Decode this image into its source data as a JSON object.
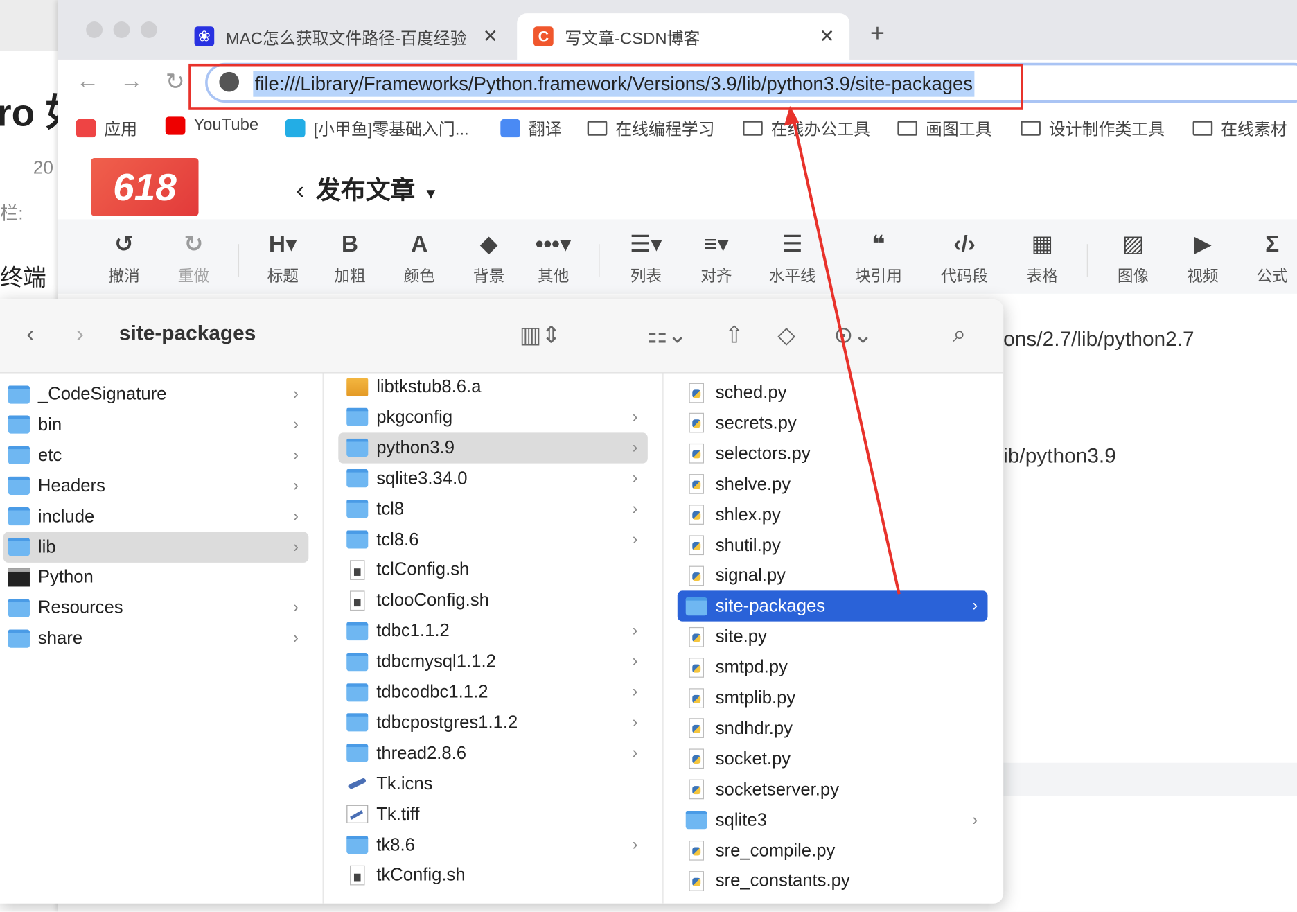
{
  "background_window": {
    "texts": [
      "ro 如",
      "20",
      "栏:",
      "终端"
    ]
  },
  "browser": {
    "tabs": [
      {
        "title": "MAC怎么获取文件路径-百度经验",
        "favicon": "baidu-paw-icon",
        "active": false
      },
      {
        "title": "写文章-CSDN博客",
        "favicon": "csdn-c-icon",
        "active": true
      }
    ],
    "new_tab": "+",
    "close": "✕",
    "url": "file:///Library/Frameworks/Python.framework/Versions/3.9/lib/python3.9/site-packages",
    "bookmarks": [
      {
        "label": "应用",
        "icon": "apps-grid-icon"
      },
      {
        "label": "YouTube",
        "icon": "youtube-icon"
      },
      {
        "label": "[小甲鱼]零基础入门...",
        "icon": "bilibili-icon"
      },
      {
        "label": "翻译",
        "icon": "google-translate-icon"
      },
      {
        "label": "在线编程学习",
        "icon": "folder-icon"
      },
      {
        "label": "在线办公工具",
        "icon": "folder-icon"
      },
      {
        "label": "画图工具",
        "icon": "folder-icon"
      },
      {
        "label": "设计制作类工具",
        "icon": "folder-icon"
      },
      {
        "label": "在线素材",
        "icon": "folder-icon"
      }
    ],
    "colors": {
      "annotation_red": "#e8322b",
      "selection": "#b7d4fb",
      "finder_selection": "#2a62d8"
    }
  },
  "csdn": {
    "logo": "618",
    "title": "发布文章",
    "tools": [
      {
        "glyph": "↺",
        "label": "撤消"
      },
      {
        "glyph": "↻",
        "label": "重做"
      },
      {
        "glyph": "H▾",
        "label": "标题"
      },
      {
        "glyph": "B",
        "label": "加粗"
      },
      {
        "glyph": "A",
        "label": "颜色"
      },
      {
        "glyph": "◆",
        "label": "背景"
      },
      {
        "glyph": "•••▾",
        "label": "其他"
      },
      {
        "glyph": "☰▾",
        "label": "列表"
      },
      {
        "glyph": "≡▾",
        "label": "对齐"
      },
      {
        "glyph": "☰",
        "label": "水平线"
      },
      {
        "glyph": "❝",
        "label": "块引用"
      },
      {
        "glyph": "‹/›",
        "label": "代码段"
      },
      {
        "glyph": "▦",
        "label": "表格"
      },
      {
        "glyph": "▨",
        "label": "图像"
      },
      {
        "glyph": "▶",
        "label": "视频"
      },
      {
        "glyph": "Σ",
        "label": "公式"
      }
    ],
    "page_text": [
      "ons/2.7/lib/python2.7",
      "ib/python3.9"
    ]
  },
  "finder": {
    "title": "site-packages",
    "columns": [
      [
        {
          "name": "_CodeSignature",
          "icon": "folder",
          "chevron": true
        },
        {
          "name": "bin",
          "icon": "folder",
          "chevron": true
        },
        {
          "name": "etc",
          "icon": "folder",
          "chevron": true
        },
        {
          "name": "Headers",
          "icon": "folder",
          "chevron": true
        },
        {
          "name": "include",
          "icon": "folder",
          "chevron": true
        },
        {
          "name": "lib",
          "icon": "folder",
          "chevron": true,
          "state": "selected"
        },
        {
          "name": "Python",
          "icon": "exec",
          "chevron": false
        },
        {
          "name": "Resources",
          "icon": "folder",
          "chevron": true
        },
        {
          "name": "share",
          "icon": "folder",
          "chevron": true
        }
      ],
      [
        {
          "name": "libtkstub8.6.a",
          "icon": "ar",
          "chevron": false
        },
        {
          "name": "pkgconfig",
          "icon": "folder",
          "chevron": true
        },
        {
          "name": "python3.9",
          "icon": "folder",
          "chevron": true,
          "state": "selected"
        },
        {
          "name": "sqlite3.34.0",
          "icon": "folder",
          "chevron": true
        },
        {
          "name": "tcl8",
          "icon": "folder",
          "chevron": true
        },
        {
          "name": "tcl8.6",
          "icon": "folder",
          "chevron": true
        },
        {
          "name": "tclConfig.sh",
          "icon": "sh",
          "chevron": false
        },
        {
          "name": "tclooConfig.sh",
          "icon": "sh",
          "chevron": false
        },
        {
          "name": "tdbc1.1.2",
          "icon": "folder",
          "chevron": true
        },
        {
          "name": "tdbcmysql1.1.2",
          "icon": "folder",
          "chevron": true
        },
        {
          "name": "tdbcodbc1.1.2",
          "icon": "folder",
          "chevron": true
        },
        {
          "name": "tdbcpostgres1.1.2",
          "icon": "folder",
          "chevron": true
        },
        {
          "name": "thread2.8.6",
          "icon": "folder",
          "chevron": true
        },
        {
          "name": "Tk.icns",
          "icon": "icns",
          "chevron": false
        },
        {
          "name": "Tk.tiff",
          "icon": "tiff",
          "chevron": false
        },
        {
          "name": "tk8.6",
          "icon": "folder",
          "chevron": true
        },
        {
          "name": "tkConfig.sh",
          "icon": "sh",
          "chevron": false
        }
      ],
      [
        {
          "name": "sched.py",
          "icon": "py",
          "chevron": false
        },
        {
          "name": "secrets.py",
          "icon": "py",
          "chevron": false
        },
        {
          "name": "selectors.py",
          "icon": "py",
          "chevron": false
        },
        {
          "name": "shelve.py",
          "icon": "py",
          "chevron": false
        },
        {
          "name": "shlex.py",
          "icon": "py",
          "chevron": false
        },
        {
          "name": "shutil.py",
          "icon": "py",
          "chevron": false
        },
        {
          "name": "signal.py",
          "icon": "py",
          "chevron": false
        },
        {
          "name": "site-packages",
          "icon": "folder",
          "chevron": true,
          "state": "active"
        },
        {
          "name": "site.py",
          "icon": "py",
          "chevron": false
        },
        {
          "name": "smtpd.py",
          "icon": "py",
          "chevron": false
        },
        {
          "name": "smtplib.py",
          "icon": "py",
          "chevron": false
        },
        {
          "name": "sndhdr.py",
          "icon": "py",
          "chevron": false
        },
        {
          "name": "socket.py",
          "icon": "py",
          "chevron": false
        },
        {
          "name": "socketserver.py",
          "icon": "py",
          "chevron": false
        },
        {
          "name": "sqlite3",
          "icon": "folder",
          "chevron": true
        },
        {
          "name": "sre_compile.py",
          "icon": "py",
          "chevron": false
        },
        {
          "name": "sre_constants.py",
          "icon": "py",
          "chevron": false
        }
      ]
    ]
  }
}
